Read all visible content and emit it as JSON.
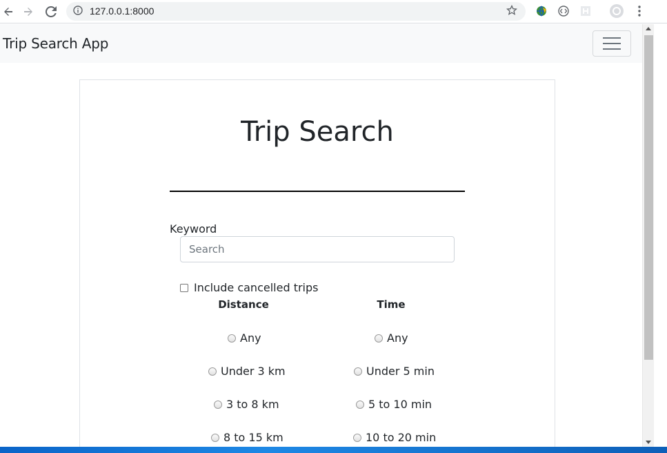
{
  "browser": {
    "url": "127.0.0.1:8000"
  },
  "navbar": {
    "brand": "Trip Search App"
  },
  "page": {
    "title": "Trip Search",
    "keyword_label": "Keyword",
    "search_placeholder": "Search",
    "search_value": "",
    "include_cancelled_label": "Include cancelled trips",
    "include_cancelled_checked": false,
    "distance_header": "Distance",
    "time_header": "Time",
    "distance_options": [
      "Any",
      "Under 3 km",
      "3 to 8 km",
      "8 to 15 km"
    ],
    "time_options": [
      "Any",
      "Under 5 min",
      "5 to 10 min",
      "10 to 20 min"
    ]
  }
}
